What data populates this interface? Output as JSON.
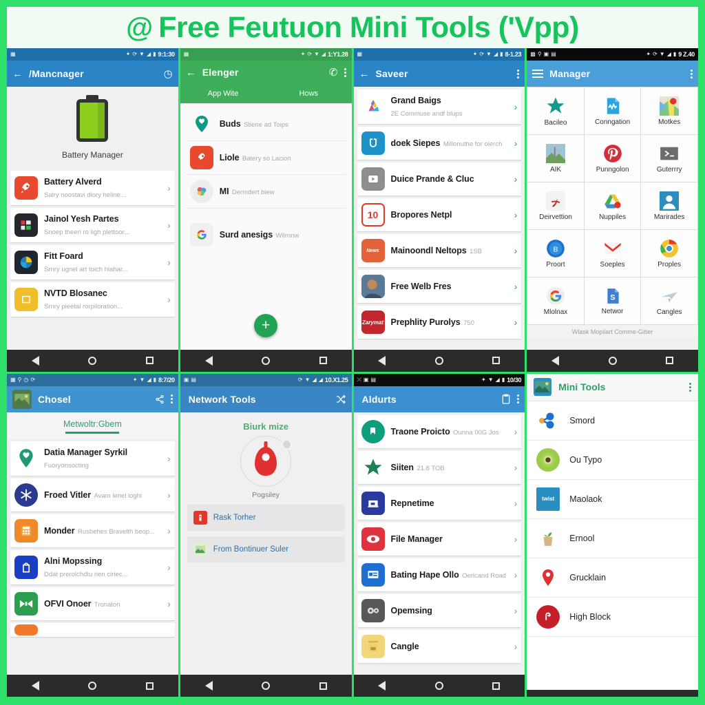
{
  "banner": {
    "at_glyph": "@",
    "title": "Free Feutuon Mini Tools ('Vpp)",
    "accent": "#16c45c"
  },
  "nav": {
    "back": "back-triangle",
    "home": "home-circle",
    "recents": "recents-square"
  },
  "screens": [
    {
      "id": "battery-manager",
      "statusbar": {
        "time": "9:1:30",
        "appbar_color": "#2b84c6",
        "status_color": "#1f6fa8"
      },
      "appbar": {
        "title": "/Mancnager",
        "left_icon": "←",
        "right_icon": "timer"
      },
      "hero": {
        "label": "Battery Manager"
      },
      "rows": [
        {
          "title": "Battery Alverd",
          "sub": "Salry noostavi diory heline...",
          "color": "#e8492f",
          "glyph": "rocket"
        },
        {
          "title": "Jainol Yesh Partes",
          "sub": "Snoep theeri ro ligh plettoor...",
          "color": "#24272b",
          "glyph": "tiles"
        },
        {
          "title": "Fitt Foard",
          "sub": "Srnry ugnel art toich hlahar...",
          "color": "#1e2630",
          "glyph": "globe"
        },
        {
          "title": "NVTD Blosanec",
          "sub": "Srnry pieetal rorpiloration...",
          "color": "#f0bd2b",
          "glyph": "box"
        }
      ]
    },
    {
      "id": "elenger",
      "statusbar": {
        "time": "1:Y1.28",
        "appbar_color": "#3fae5b",
        "status_color": "#389e52"
      },
      "appbar": {
        "title": "Elenger",
        "left_icon": "←",
        "right_icon": "call"
      },
      "tabs": [
        "App Wite",
        "Hows"
      ],
      "rows": [
        {
          "title": "Buds",
          "sub": "Stiene ad Toips",
          "color": "#0f9a86",
          "glyph": "pin-heart"
        },
        {
          "title": "Liole",
          "sub": "Batery so Lacion",
          "color": "#e8492f",
          "glyph": "rocket"
        },
        {
          "title": "MI",
          "sub": "Dermdert biew",
          "color": "#ededed",
          "glyph": "balloons"
        },
        {
          "title": "Surd anesigs",
          "sub": "Wilrnnw",
          "color": "#f0f0f0",
          "glyph": "google-g"
        }
      ],
      "fab": "+"
    },
    {
      "id": "saveer",
      "statusbar": {
        "time": "8-1.23",
        "appbar_color": "#2b84c6",
        "status_color": "#1f6fa8"
      },
      "appbar": {
        "title": "Saveer",
        "left_icon": "←",
        "right_icon": "kebab"
      },
      "rows": [
        {
          "title": "Grand Baigs",
          "sub": "2E Commuse andf blups",
          "color": "#ffffff",
          "glyph": "drive-tri"
        },
        {
          "title": "doek Siepes",
          "sub": "Millonuthe for olerch",
          "color": "#1f93c9",
          "glyph": "magnet"
        },
        {
          "title": "Duice Prande & Cluc",
          "sub": "",
          "color": "#8e8e8e",
          "glyph": "play-card"
        },
        {
          "title": "Bropores Netpl",
          "sub": "",
          "color": "#e03a2b",
          "glyph": "cal-10"
        },
        {
          "title": "Mainoondl Neltops",
          "sub": "1SB",
          "color": "#e2633a",
          "glyph": "news"
        },
        {
          "title": "Free Welb Fres",
          "sub": "",
          "color": "#4c6a86",
          "glyph": "photo"
        },
        {
          "title": "Prephlity Purolys",
          "sub": "750",
          "color": "#c1272d",
          "glyph": "script"
        }
      ]
    },
    {
      "id": "manager-grid",
      "statusbar": {
        "time": "9 Z.40",
        "appbar_color": "#4a9fd8",
        "status_color": "#0a0a0a"
      },
      "appbar": {
        "title": "Manager",
        "left_icon": "menu",
        "right_icon": "kebab"
      },
      "tiles": [
        {
          "label": "Bacileo",
          "color": "#17998a",
          "glyph": "star"
        },
        {
          "label": "Conngation",
          "color": "#2aa5e0",
          "glyph": "wave-doc"
        },
        {
          "label": "Motkes",
          "color": "#ffffff",
          "glyph": "maps"
        },
        {
          "label": "AIK",
          "color": "#9ec4d6",
          "glyph": "photo"
        },
        {
          "label": "Punngolon",
          "color": "#d42d3c",
          "glyph": "pinterest"
        },
        {
          "label": "Guterrry",
          "color": "#6c6c6c",
          "glyph": "board"
        },
        {
          "label": "Deirvettion",
          "color": "#f2f2f2",
          "glyph": "acrobat"
        },
        {
          "label": "Nuppiles",
          "color": "#ffffff",
          "glyph": "drive-tri"
        },
        {
          "label": "Marirades",
          "color": "#2a8fc0",
          "glyph": "contact"
        },
        {
          "label": "Proort",
          "color": "#1f6fcb",
          "glyph": "blue-badge"
        },
        {
          "label": "Soeples",
          "color": "#f5f5f5",
          "glyph": "gmail"
        },
        {
          "label": "Proples",
          "color": "#ffffff",
          "glyph": "chrome"
        },
        {
          "label": "Mlolnax",
          "color": "#ededed",
          "glyph": "google-g"
        },
        {
          "label": "Networ",
          "color": "#3e7fd5",
          "glyph": "slides-s"
        },
        {
          "label": "Cangles",
          "color": "#b9cfd4",
          "glyph": "plane"
        }
      ],
      "footer": "Wlask Mopilart Comme-Gitier"
    },
    {
      "id": "chosel",
      "statusbar": {
        "time": "8:7/20",
        "appbar_color": "#3f93cf",
        "status_color": "#2b6f9e"
      },
      "appbar": {
        "title": "Chosel",
        "left_icon": "thumb",
        "right_icon": "share"
      },
      "section_tab": "Metwoltr:Gbem",
      "rows": [
        {
          "title": "Datia Manager Syrkil",
          "sub": "Fuoryonsocting",
          "color": "#1f9a72",
          "glyph": "pin-heart"
        },
        {
          "title": "Froed Vitler",
          "sub": "Avam lenel loghi",
          "color": "#2a3a8f",
          "glyph": "snowflake"
        },
        {
          "title": "Monder",
          "sub": "Rusbehes Bravelth beop...",
          "color": "#ef8a2b",
          "glyph": "calc"
        },
        {
          "title": "Alni Mopssing",
          "sub": "Ddat prerolchdtu rien ciriec...",
          "color": "#1b3fc4",
          "glyph": "bag"
        },
        {
          "title": "OFVI Onoer",
          "sub": "Tronaton",
          "color": "#2b9e4f",
          "glyph": "bowtie"
        },
        {
          "title": "",
          "sub": "",
          "color": "#ef7a2b",
          "glyph": "box"
        }
      ]
    },
    {
      "id": "network-tools",
      "statusbar": {
        "time": "10.X1.25",
        "appbar_color": "#3a86c4",
        "status_color": "#2b6f9e"
      },
      "appbar": {
        "title": "Network Tools",
        "left_icon": "",
        "right_icon": "shuffle"
      },
      "center": {
        "title": "Biurk mize",
        "caption": "Pogsiley"
      },
      "buttons": [
        {
          "label": "Rask Torher",
          "color": "#e0392b",
          "glyph": "ruler"
        },
        {
          "label": "From Bontinuer Suler",
          "color": "#dff0d0",
          "glyph": "photo-sm"
        }
      ]
    },
    {
      "id": "aldurts",
      "statusbar": {
        "time": "10/30",
        "appbar_color": "#3a8fd0",
        "status_color": "#0d0d0d"
      },
      "appbar": {
        "title": "Aldurts",
        "left_icon": "",
        "right_icon": "clipboard"
      },
      "rows": [
        {
          "title": "Traone Proicto",
          "sub": "Ounna 00G Jos",
          "color": "#0d9e7b",
          "glyph": "rnd-doc"
        },
        {
          "title": "Siiten",
          "sub": "21.8 TOB",
          "color": "#1d7f56",
          "glyph": "star"
        },
        {
          "title": "Repnetime",
          "sub": "",
          "color": "#2a3a9f",
          "glyph": "screen"
        },
        {
          "title": "File Manager",
          "sub": "",
          "color": "#e0313f",
          "glyph": "eye"
        },
        {
          "title": "Bating Hape Ollo",
          "sub": "Oerlcand Road",
          "color": "#1f6fd0",
          "glyph": "card"
        },
        {
          "title": "Opemsing",
          "sub": "",
          "color": "#585858",
          "glyph": "gears"
        },
        {
          "title": "Cangle",
          "sub": "",
          "color": "#f2d77a",
          "glyph": "toolbox"
        }
      ]
    },
    {
      "id": "mini-tools",
      "header": {
        "title": "Mini Tools",
        "right_icon": "kebab"
      },
      "rows": [
        {
          "label": "Smord",
          "color": "#1f6fd0",
          "glyph": "share-node"
        },
        {
          "label": "Ou Typo",
          "color": "#9ccb4a",
          "glyph": "avocado"
        },
        {
          "label": "Maolaok",
          "color": "#2a8fc0",
          "glyph": "label-twist"
        },
        {
          "label": "Ernool",
          "color": "#d7b487",
          "glyph": "plant-bag"
        },
        {
          "label": "Grucklain",
          "color": "#e03030",
          "glyph": "pin"
        },
        {
          "label": "High Block",
          "color": "#c4202a",
          "glyph": "spiral"
        }
      ]
    }
  ]
}
